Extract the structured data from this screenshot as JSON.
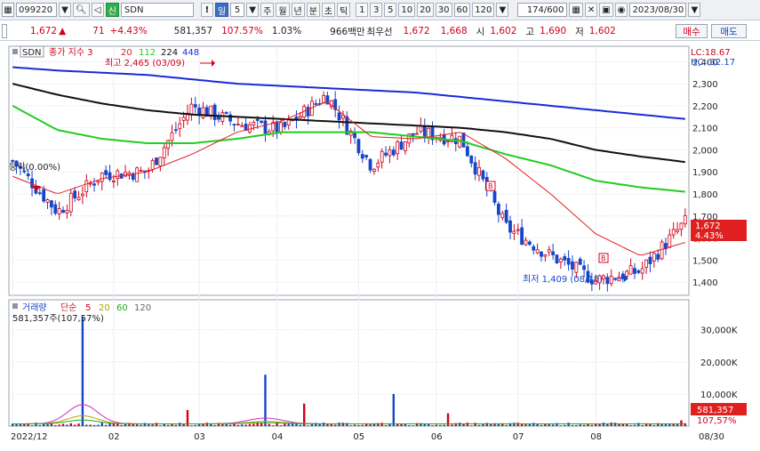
{
  "toolbar": {
    "code": "099220",
    "badge": "신",
    "name": "SDN",
    "excl": "!",
    "period_selected": "일",
    "period_num": "5",
    "periods": [
      "주",
      "월",
      "년",
      "분",
      "초",
      "틱"
    ],
    "intervals": [
      "1",
      "3",
      "5",
      "10",
      "20",
      "30",
      "60",
      "120"
    ],
    "count": "174/600",
    "date": "2023/08/30"
  },
  "infobar": {
    "price": "1,672",
    "change": "71",
    "change_pct": "+4.43%",
    "volume": "581,357",
    "volume_ratio": "107.57%",
    "turnover": "1.03%",
    "amount": "966백만",
    "best_ask_label": "최우선",
    "best_ask": "1,672",
    "best_bid": "1,668",
    "open_label": "시",
    "open": "1,602",
    "high_label": "고",
    "high": "1,690",
    "low_label": "저",
    "low": "1,602",
    "buy_label": "매수",
    "sell_label": "매도"
  },
  "price_panel": {
    "legend_name": "SDN",
    "legend_label": "종가 지수 3",
    "ma_periods": [
      "20",
      "112",
      "224",
      "448"
    ],
    "lc_label": "LC:18.67",
    "hc_label": "HC:-32.17",
    "high_annotation": "최고 2,465 (03/09)",
    "low_annotation": "최저 1,409 (08/18)",
    "left_annotation": "등락(0.00%)",
    "last_price": "1,672",
    "last_pct": "4.43%",
    "y_ticks": [
      "2,400",
      "2,300",
      "2,200",
      "2,100",
      "2,000",
      "1,900",
      "1,800",
      "1,700",
      "1,600",
      "1,500",
      "1,400"
    ],
    "colors": {
      "up": "#d0021b",
      "down": "#1646c8",
      "ma20": "#e02020",
      "ma112": "#22cc22",
      "ma224": "#111111",
      "ma448": "#1a2ad6"
    }
  },
  "volume_panel": {
    "legend_label": "거래량",
    "legend_type": "단순",
    "ma_periods": [
      "5",
      "20",
      "60",
      "120"
    ],
    "vol_text": "581,357주(107,57%)",
    "y_ticks": [
      "30,000K",
      "20,000K",
      "10,000K"
    ],
    "last_vol": "581,357",
    "last_pct": "107,57%"
  },
  "x_axis": [
    "2022/12",
    "02",
    "03",
    "04",
    "05",
    "06",
    "07",
    "08",
    "08/30"
  ],
  "chart_data": {
    "type": "candlestick",
    "price_ylim": [
      1340,
      2470
    ],
    "price_anchors_date": [
      "2022/12",
      "01",
      "02",
      "03",
      "03/09",
      "04",
      "05",
      "06",
      "07",
      "08",
      "08/18",
      "08/30"
    ],
    "close_path": [
      1950,
      1720,
      1890,
      1900,
      2200,
      2120,
      2090,
      2250,
      1930,
      2080,
      2050,
      1650,
      1520,
      1409,
      1450,
      1672
    ],
    "ma20_path": [
      1880,
      1800,
      1870,
      1900,
      1980,
      2080,
      2130,
      2220,
      2060,
      2050,
      2080,
      1960,
      1800,
      1620,
      1520,
      1580
    ],
    "ma112_path": [
      2200,
      2090,
      2050,
      2030,
      2030,
      2050,
      2080,
      2080,
      2080,
      2060,
      2040,
      1980,
      1930,
      1860,
      1830,
      1810
    ],
    "ma224_path": [
      2300,
      2250,
      2210,
      2180,
      2160,
      2150,
      2140,
      2130,
      2120,
      2110,
      2100,
      2080,
      2050,
      2000,
      1970,
      1945
    ],
    "ma448_path": [
      2375,
      2360,
      2350,
      2340,
      2320,
      2300,
      2290,
      2280,
      2270,
      2260,
      2240,
      2220,
      2200,
      2180,
      2160,
      2140
    ],
    "volume_peaks_K": [
      {
        "idx": 18,
        "v": 34000
      },
      {
        "idx": 45,
        "v": 5000
      },
      {
        "idx": 65,
        "v": 16000
      },
      {
        "idx": 98,
        "v": 10000
      },
      {
        "idx": 75,
        "v": 7000
      },
      {
        "idx": 112,
        "v": 4000
      },
      {
        "idx": 172,
        "v": 1800
      }
    ],
    "volume_ylim_K": [
      0,
      36000
    ],
    "grid": true
  }
}
